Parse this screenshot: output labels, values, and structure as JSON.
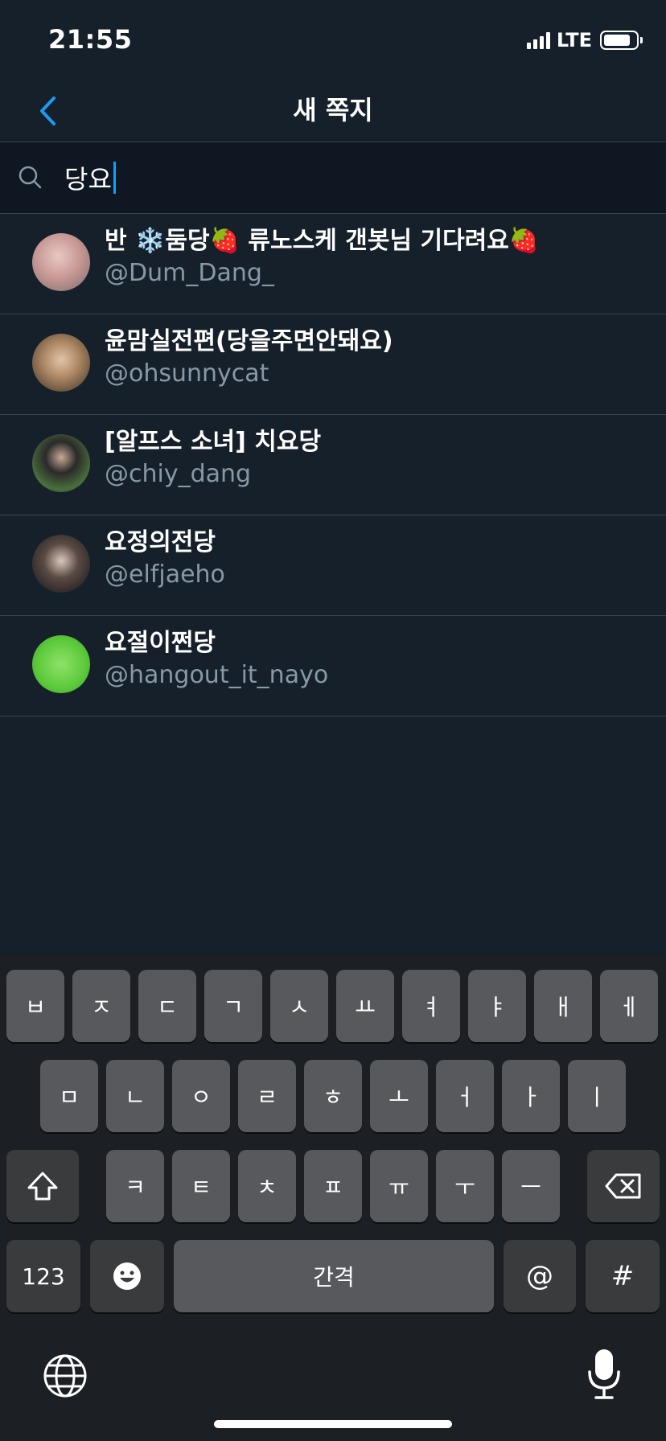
{
  "status_bar": {
    "time": "21:55",
    "network": "LTE",
    "battery_level": 0.85
  },
  "nav": {
    "title": "새 쪽지",
    "back_icon": "chevron-left-icon"
  },
  "search": {
    "value": "당요",
    "icon": "search-icon"
  },
  "results": [
    {
      "name": "반 ❄️둠당🍓 류노스케 갠봇님 기다려요🍓",
      "handle": "@Dum_Dang_",
      "avatar_color": "#c9a6a2"
    },
    {
      "name": "윤맘실전편(당을주면안돼요)",
      "handle": "@ohsunnycat",
      "avatar_color": "#b89878"
    },
    {
      "name": "[알프스 소녀] 치요당",
      "handle": "@chiy_dang",
      "avatar_color": "#3d5a3a"
    },
    {
      "name": "요정의전당",
      "handle": "@elfjaeho",
      "avatar_color": "#2a2d30"
    },
    {
      "name": "요절이쩐당",
      "handle": "@hangout_it_nayo",
      "avatar_color": "#6bd64a"
    }
  ],
  "keyboard": {
    "row1": [
      "ㅂ",
      "ㅈ",
      "ㄷ",
      "ㄱ",
      "ㅅ",
      "ㅛ",
      "ㅕ",
      "ㅑ",
      "ㅐ",
      "ㅔ"
    ],
    "row2": [
      "ㅁ",
      "ㄴ",
      "ㅇ",
      "ㄹ",
      "ㅎ",
      "ㅗ",
      "ㅓ",
      "ㅏ",
      "ㅣ"
    ],
    "row3": [
      "ㅋ",
      "ㅌ",
      "ㅊ",
      "ㅍ",
      "ㅠ",
      "ㅜ",
      "ㅡ"
    ],
    "numbers_label": "123",
    "space_label": "간격",
    "at_label": "@",
    "hash_label": "#",
    "shift_icon": "shift-icon",
    "delete_icon": "delete-icon",
    "emoji_icon": "emoji-icon",
    "globe_icon": "globe-icon",
    "mic_icon": "microphone-icon"
  }
}
